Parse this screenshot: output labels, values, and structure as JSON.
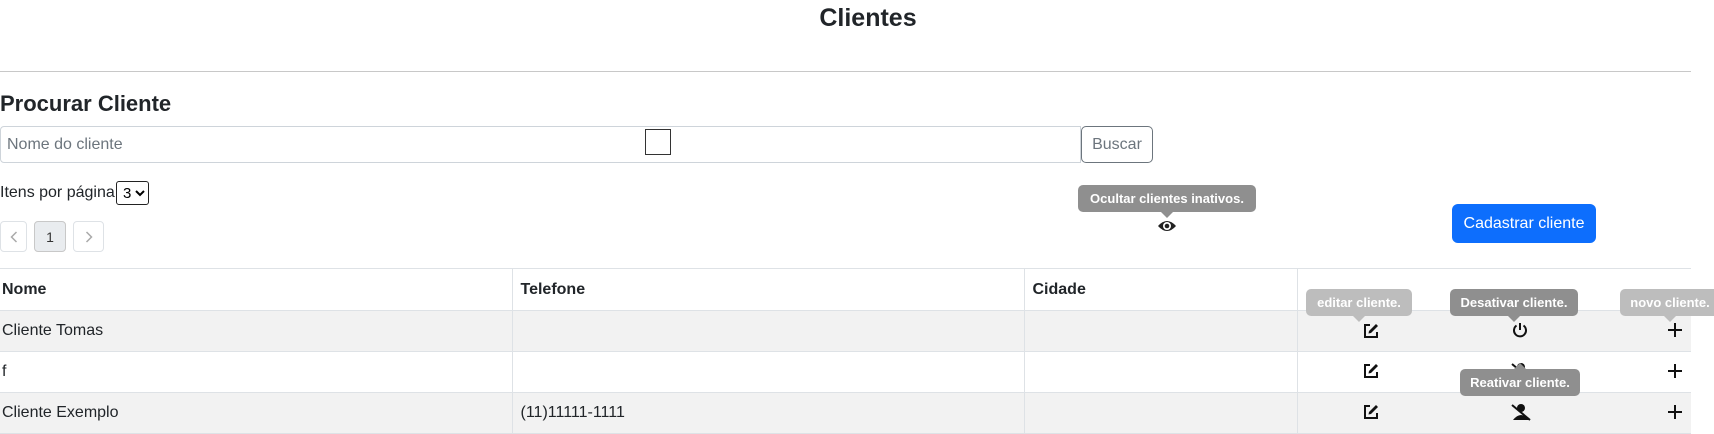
{
  "page": {
    "title": "Clientes"
  },
  "search": {
    "section_title": "Procurar Cliente",
    "placeholder": "Nome do cliente",
    "button_label": "Buscar"
  },
  "pagination": {
    "per_page_label": "Itens por página:",
    "per_page_value": "3",
    "per_page_options": [
      "3"
    ],
    "current_page": "1",
    "prev_icon": "chevron-left-icon",
    "next_icon": "chevron-right-icon"
  },
  "toolbar": {
    "hide_inactive_tooltip": "Ocultar clientes inativos.",
    "hide_inactive_icon": "eye-icon",
    "register_button_label": "Cadastrar cliente"
  },
  "table": {
    "columns": [
      "Nome",
      "Telefone",
      "Cidade",
      ""
    ],
    "rows": [
      {
        "nome": "Cliente Tomas",
        "telefone": "",
        "cidade": "",
        "status_action": "power-icon"
      },
      {
        "nome": "f",
        "telefone": "",
        "cidade": "",
        "status_action": "user-slash-icon"
      },
      {
        "nome": "Cliente Exemplo",
        "telefone": "(11)11111-1111",
        "cidade": "",
        "status_action": "user-slash-icon"
      }
    ],
    "tooltips": {
      "edit": "editar cliente.",
      "deactivate": "Desativar cliente.",
      "new": "novo cliente.",
      "reactivate": "Reativar cliente."
    }
  },
  "colors": {
    "primary": "#0d6efd",
    "tooltip": "#8f8f8f",
    "striped_row": "#f2f2f2"
  }
}
